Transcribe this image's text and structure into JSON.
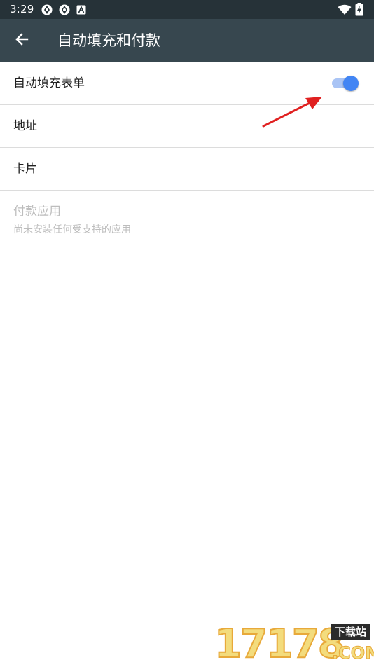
{
  "status_bar": {
    "time": "3:29",
    "icons": [
      "settings-icon",
      "settings-icon",
      "a-icon",
      "wifi-icon",
      "battery-charging-icon"
    ]
  },
  "app_bar": {
    "title": "自动填充和付款",
    "back_icon": "arrow-back-icon"
  },
  "list": {
    "autofill": {
      "label": "自动填充表单",
      "enabled": true
    },
    "addresses": {
      "label": "地址"
    },
    "cards": {
      "label": "卡片"
    },
    "payment_apps": {
      "label": "付款应用",
      "summary": "尚未安装任何受支持的应用"
    }
  },
  "watermark": {
    "digits": "17178",
    "badge": "下载站",
    "domain": ".COM"
  },
  "colors": {
    "status_bar": "#263238",
    "app_bar": "#37474f",
    "switch_thumb": "#4285f4",
    "switch_track": "#a9c4f5",
    "annotation_arrow": "#e02020"
  }
}
